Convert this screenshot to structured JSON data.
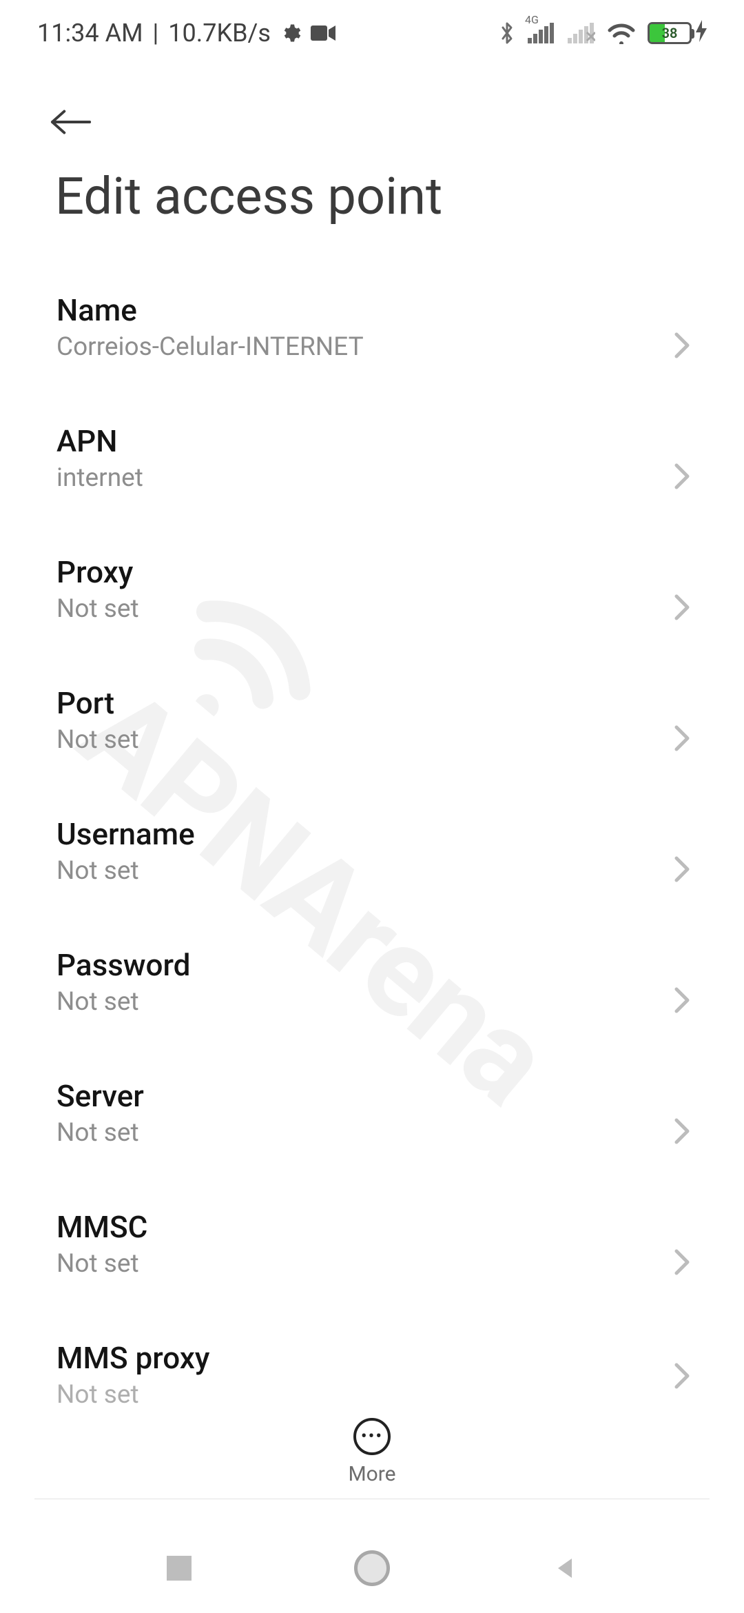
{
  "status": {
    "time": "11:34 AM",
    "separator": "|",
    "data_rate": "10.7KB/s",
    "signal_label": "4G",
    "battery_percent": "38"
  },
  "header": {
    "title": "Edit access point"
  },
  "fields": [
    {
      "label": "Name",
      "value": "Correios-Celular-INTERNET"
    },
    {
      "label": "APN",
      "value": "internet"
    },
    {
      "label": "Proxy",
      "value": "Not set"
    },
    {
      "label": "Port",
      "value": "Not set"
    },
    {
      "label": "Username",
      "value": "Not set"
    },
    {
      "label": "Password",
      "value": "Not set"
    },
    {
      "label": "Server",
      "value": "Not set"
    },
    {
      "label": "MMSC",
      "value": "Not set"
    },
    {
      "label": "MMS proxy",
      "value": "Not set"
    }
  ],
  "footer": {
    "more_label": "More"
  },
  "watermark": "APNArena"
}
